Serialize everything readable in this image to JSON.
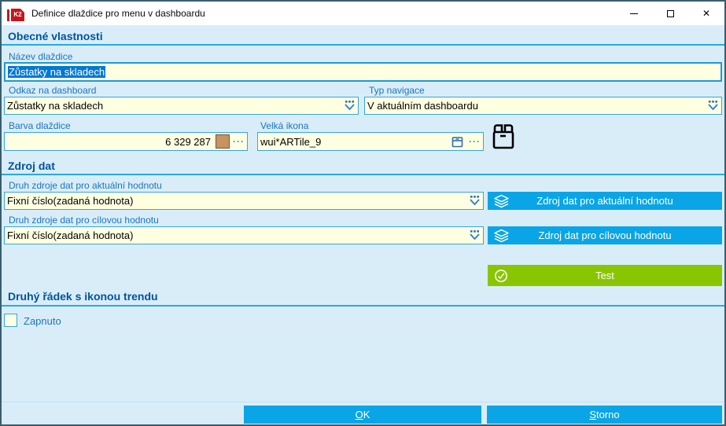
{
  "window": {
    "title": "Definice dlaždice pro menu v dashboardu",
    "logo_text": "K2"
  },
  "sections": {
    "general": {
      "title": "Obecné vlastnosti"
    },
    "data_source": {
      "title": "Zdroj dat"
    },
    "trend": {
      "title": "Druhý řádek s ikonou trendu"
    }
  },
  "fields": {
    "tile_name": {
      "label": "Název dlaždice",
      "value": "Zůstatky na skladech"
    },
    "dashboard_link": {
      "label": "Odkaz na dashboard",
      "value": "Zůstatky na skladech"
    },
    "navigation_type": {
      "label": "Typ navigace",
      "value": "V aktuálním dashboardu"
    },
    "tile_color": {
      "label": "Barva dlaždice",
      "value": "6 329 287",
      "swatch_style": "background:#C79360",
      "ellipsis": "···"
    },
    "big_icon": {
      "label": "Velká ikona",
      "value": "wui*ARTile_9",
      "ellipsis": "···"
    },
    "current_value_source_type": {
      "label": "Druh zdroje dat pro aktuální hodnotu",
      "value": "Fixní číslo(zadaná hodnota)"
    },
    "target_value_source_type": {
      "label": "Druh zdroje dat pro cílovou hodnotu",
      "value": "Fixní číslo(zadaná hodnota)"
    }
  },
  "buttons": {
    "current_source": "Zdroj dat pro aktuální hodnotu",
    "target_source": "Zdroj dat pro cílovou hodnotu",
    "test": "Test",
    "ok": "OK",
    "cancel": "Storno"
  },
  "checkbox": {
    "label": "Zapnuto",
    "checked": false
  },
  "colors": {
    "accent": "#29A9E2",
    "button_blue": "#0AA5E6",
    "button_green": "#8AC502",
    "selection": "#0078D7",
    "field_bg": "#FFFFE1",
    "tile_swatch": "#C79360"
  }
}
